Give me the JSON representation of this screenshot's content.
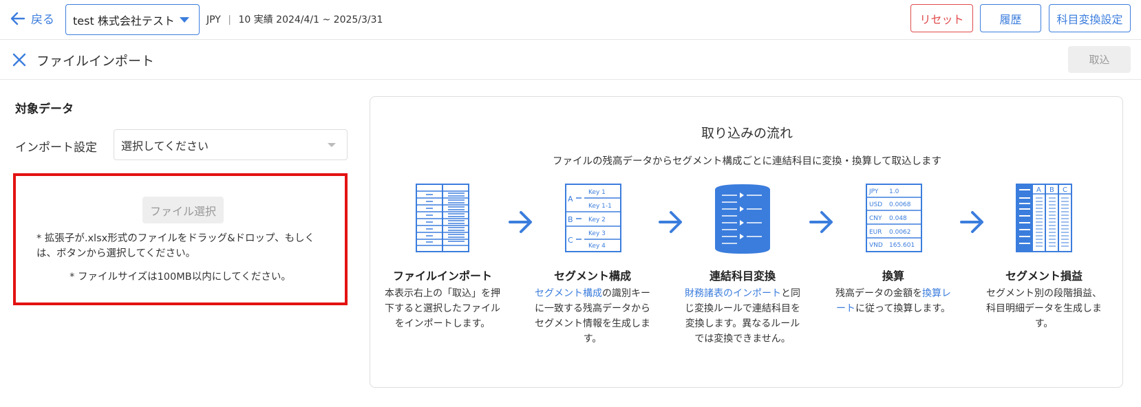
{
  "header": {
    "back_label": "戻る",
    "company": "test 株式会社テスト",
    "currency": "JPY",
    "period_separator": "|",
    "period": "10 実績 2024/4/1 ~ 2025/3/31",
    "reset_label": "リセット",
    "history_label": "履歴",
    "mapping_label": "科目変換設定"
  },
  "subheader": {
    "title": "ファイルインポート",
    "import_label": "取込"
  },
  "left": {
    "section_title": "対象データ",
    "setting_label": "インポート設定",
    "setting_placeholder": "選択してください",
    "file_select_label": "ファイル選択",
    "note1": "* 拡張子が.xlsx形式のファイルをドラッグ&ドロップ、もしくは、ボタンから選択してください。",
    "note2": "* ファイルサイズは100MB以内にしてください。"
  },
  "flow": {
    "title": "取り込みの流れ",
    "subtitle": "ファイルの残高データからセグメント構成ごとに連結科目に変換・換算して取込します",
    "steps": [
      {
        "title": "ファイルインポート",
        "desc": "本表示右上の「取込」を押下すると選択したファイルをインポートします。"
      },
      {
        "title": "セグメント構成",
        "desc_link": "セグメント構成",
        "desc_rest": "の識別キーに一致する残高データからセグメント情報を生成します。",
        "keys": [
          "Key 1",
          "Key 1-1",
          "Key 2",
          "Key 3",
          "Key 4"
        ],
        "groups": [
          "A",
          "B",
          "C"
        ]
      },
      {
        "title": "連結科目変換",
        "desc_link": "財務諸表のインポート",
        "desc_rest": "と同じ変換ルールで連結科目を変換します。異なるルールでは変換できません。"
      },
      {
        "title": "換算",
        "desc_pre": "残高データの金額を",
        "desc_link": "換算レート",
        "desc_rest": "に従って換算します。",
        "rates": [
          {
            "code": "JPY",
            "rate": "1.0"
          },
          {
            "code": "USD",
            "rate": "0.0068"
          },
          {
            "code": "CNY",
            "rate": "0.048"
          },
          {
            "code": "EUR",
            "rate": "0.0062"
          },
          {
            "code": "VND",
            "rate": "165.601"
          }
        ]
      },
      {
        "title": "セグメント損益",
        "desc": "セグメント別の段階損益、科目明細データを生成します。",
        "columns": [
          "A",
          "B",
          "C"
        ]
      }
    ]
  },
  "colors": {
    "accent": "#3b7ddd",
    "danger": "#e04a4a",
    "highlight_border": "#e31212",
    "illustration": "#3b7ddd"
  }
}
